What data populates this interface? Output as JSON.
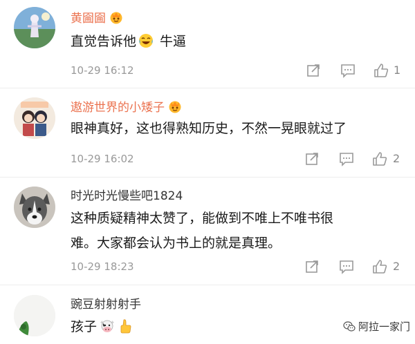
{
  "comments": [
    {
      "name": "黄圇圇",
      "vip": true,
      "text_before": "直觉告诉他",
      "emoji": "laughing-with-tears",
      "text_after": " 牛逼",
      "time": "10-29 16:12",
      "likes": "1"
    },
    {
      "name": "遨游世界的小矮子",
      "vip": true,
      "text": "眼神真好，这也得熟知历史，不然一晃眼就过了",
      "time": "10-29 16:02",
      "likes": "2"
    },
    {
      "name": "时光时光慢些吧1824",
      "vip": false,
      "text_line1": "这种质疑精神太赞了，能做到不唯上不唯书很",
      "text_line2": "难。大家都会认为书上的就是真理。",
      "time": "10-29 18:23",
      "likes": "2"
    },
    {
      "name": "豌豆射射射手",
      "vip": false,
      "text": "孩子",
      "emojis": [
        "cow-face",
        "thumbs-up"
      ]
    }
  ],
  "watermark": {
    "text": "阿拉一家门",
    "icon": "wechat-icon"
  },
  "icons": {
    "repost": "repost-icon",
    "comment": "comment-icon",
    "like": "like-icon"
  },
  "colors": {
    "vip_name": "#eb7350",
    "plain_name": "#333333",
    "meta": "#999999",
    "text": "#1a1a1a"
  }
}
